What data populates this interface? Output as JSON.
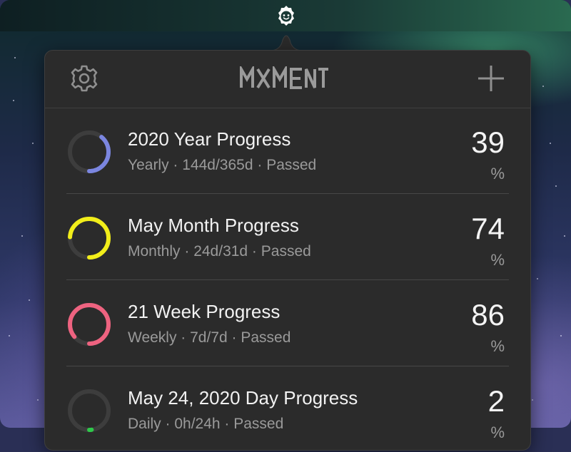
{
  "app": {
    "name": "MOMENT",
    "logo_text": "MXMENT",
    "menubar_icon": "moment-face-icon",
    "settings_icon": "gear-icon",
    "add_icon": "plus-icon"
  },
  "progress_items": [
    {
      "title": "2020 Year Progress",
      "subtitle": "Yearly · 144d/365d · Passed",
      "value": "39",
      "unit": "%",
      "percent": 39,
      "color": "#7b86e0"
    },
    {
      "title": "May Month Progress",
      "subtitle": "Monthly · 24d/31d · Passed",
      "value": "74",
      "unit": "%",
      "percent": 74,
      "color": "#f2ee1a"
    },
    {
      "title": "21 Week Progress",
      "subtitle": "Weekly · 7d/7d · Passed",
      "value": "86",
      "unit": "%",
      "percent": 86,
      "color": "#ee6380"
    },
    {
      "title": "May 24, 2020 Day Progress",
      "subtitle": "Daily · 0h/24h · Passed",
      "value": "2",
      "unit": "%",
      "percent": 2,
      "color": "#2ec84a"
    }
  ],
  "colors": {
    "popover_bg": "#2b2b2b",
    "ring_track": "#3d3d3d",
    "text_primary": "#f2f2f2",
    "text_secondary": "#9a9a9a"
  }
}
